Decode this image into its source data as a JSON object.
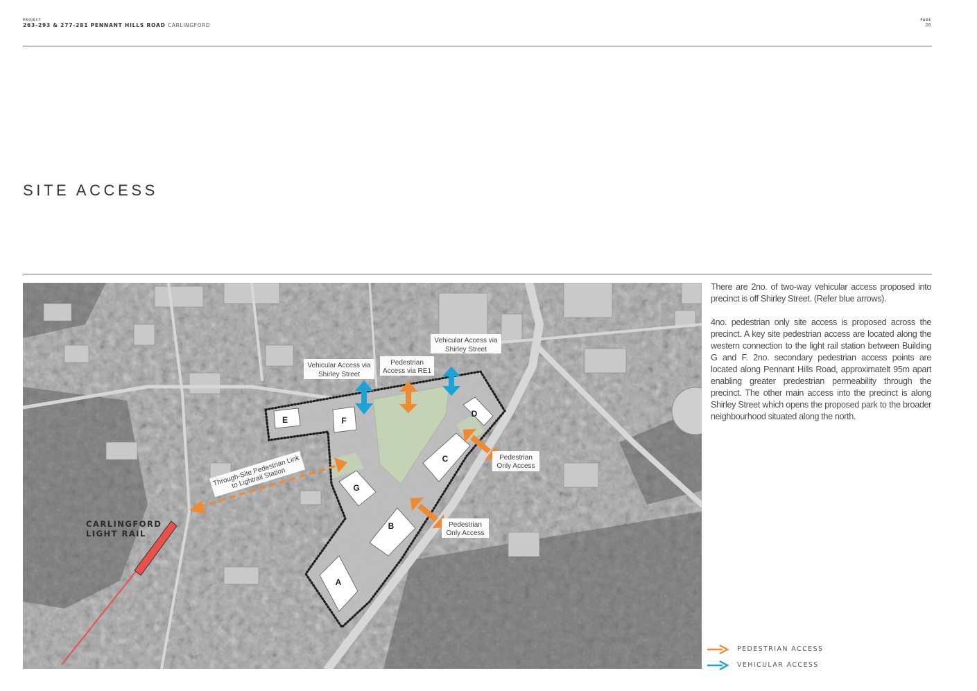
{
  "header": {
    "project_label": "PROJECT",
    "project_address": "263-293 & 277-281 PENNANT HILLS ROAD",
    "project_suburb": "CARLINGFORD",
    "page_label": "PAGE",
    "page_number": "26"
  },
  "title": "SITE ACCESS",
  "map": {
    "station_name": [
      "CARLINGFORD",
      "LIGHT RAIL"
    ],
    "buildings": [
      "A",
      "B",
      "C",
      "D",
      "E",
      "F",
      "G"
    ],
    "callouts": {
      "vehicular_left": [
        "Vehicular Access via",
        "Shirley Street"
      ],
      "pedestrian_re1": [
        "Pedestrian",
        "Access via RE1"
      ],
      "vehicular_right": [
        "Vehicular Access via",
        "Shirley Street"
      ],
      "pedestrian_east_upper": [
        "Pedestrian",
        "Only Access"
      ],
      "pedestrian_east_lower": [
        "Pedestrian",
        "Only Access"
      ],
      "through_site_link": [
        "Through-Site Pedestrian Link",
        "to Lightrail Station"
      ]
    }
  },
  "description": [
    "There are 2no. of two-way vehicular access proposed into precinct is off Shirley Street. (Refer blue arrows).",
    "4no. pedestrian only site access is proposed across the precinct. A key site pedestrian access are located along the western connection to the light rail station between Building G and F. 2no. secondary pedestrian access points are located along Pennant Hills Road, approximatelt 95m apart enabling greater predestrian permeability through the precinct. The other main access into the precinct is along Shirley Street which opens the proposed park to the broader neighbourhood situated along the north."
  ],
  "legend": [
    {
      "label": "PEDESTRIAN ACCESS",
      "color": "#f08a32"
    },
    {
      "label": "VEHICULAR ACCESS",
      "color": "#1aa3d6"
    }
  ],
  "colors": {
    "pedestrian": "#f08a32",
    "vehicular": "#1aa3d6",
    "light_rail": "#e8524a",
    "park": "#c4d3b5"
  }
}
